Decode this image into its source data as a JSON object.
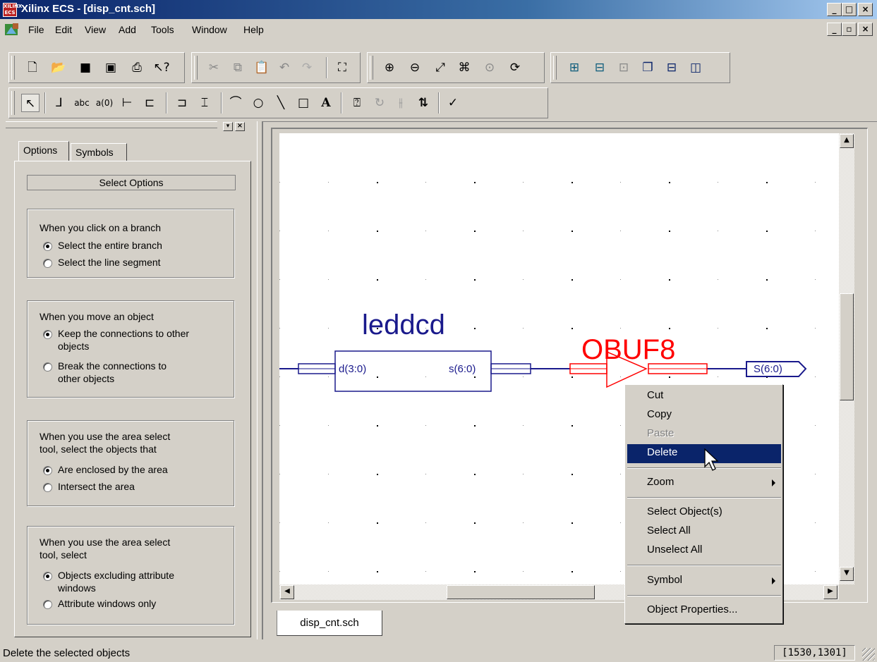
{
  "window": {
    "title": "Xilinx ECS - [disp_cnt.sch]",
    "app_icon_text": "ECS"
  },
  "menubar": {
    "items": [
      "File",
      "Edit",
      "View",
      "Add",
      "Tools",
      "Window",
      "Help"
    ]
  },
  "toolbar_main": {
    "icons": [
      "new-icon",
      "open-icon",
      "save-icon",
      "save-all-icon",
      "print-icon",
      "context-help-icon",
      "cut-icon",
      "copy-icon",
      "paste-icon",
      "undo-icon",
      "redo-icon",
      "find-icon",
      "zoom-in-icon",
      "zoom-out-icon",
      "zoom-full-icon",
      "zoom-to-box-icon",
      "zoom-selected-icon",
      "refresh-icon",
      "hierarchy-push-icon",
      "hierarchy-pop-icon",
      "symbol-icon",
      "cascade-icon",
      "tile-horizontal-icon",
      "tile-vertical-icon"
    ]
  },
  "toolbar_draw": {
    "icons": [
      "select-icon",
      "add-wire-icon",
      "add-net-name-icon",
      "add-bus-tap-icon",
      "add-io-marker-icon",
      "add-symbol-icon",
      "add-bus-icon",
      "add-instance-icon",
      "add-arc-icon",
      "add-circle-icon",
      "add-line-icon",
      "add-rectangle-icon",
      "add-text-icon",
      "symbol-info-icon",
      "rotate-icon",
      "mirror-icon",
      "swap-icon",
      "check-schematic-icon"
    ]
  },
  "left_panel": {
    "tabs": [
      "Options",
      "Symbols"
    ],
    "header": "Select Options",
    "groups": [
      {
        "prompt": [
          "When you click on a branch"
        ],
        "options": [
          {
            "label": [
              "Select the entire branch"
            ],
            "checked": true
          },
          {
            "label": [
              "Select the line segment"
            ],
            "checked": false
          }
        ]
      },
      {
        "prompt": [
          "When you move an object"
        ],
        "options": [
          {
            "label": [
              "Keep the connections to other",
              "objects"
            ],
            "checked": true
          },
          {
            "label": [
              "Break the connections to",
              "other objects"
            ],
            "checked": false
          }
        ]
      },
      {
        "prompt": [
          "When you use the area select",
          "tool, select the objects that"
        ],
        "options": [
          {
            "label": [
              "Are enclosed by the area"
            ],
            "checked": true
          },
          {
            "label": [
              "Intersect the area"
            ],
            "checked": false
          }
        ]
      },
      {
        "prompt": [
          "When you use the area select",
          "tool, select"
        ],
        "options": [
          {
            "label": [
              "Objects excluding attribute",
              "windows"
            ],
            "checked": true
          },
          {
            "label": [
              "Attribute windows only"
            ],
            "checked": false
          }
        ]
      }
    ]
  },
  "schematic": {
    "symbol1": {
      "name": "leddcd",
      "pin_in": "d(3:0)",
      "pin_out": "s(6:0)",
      "color": "#1a1a8c"
    },
    "symbol2": {
      "name": "OBUF8",
      "color": "#ff0000"
    },
    "io_marker": "S(6:0)",
    "sheet_tab": "disp_cnt.sch"
  },
  "context_menu": {
    "items": [
      {
        "label": "Cut",
        "state": "normal"
      },
      {
        "label": "Copy",
        "state": "normal"
      },
      {
        "label": "Paste",
        "state": "disabled"
      },
      {
        "label": "Delete",
        "state": "selected"
      },
      {
        "label": "Zoom",
        "state": "submenu"
      },
      {
        "label": "Select Object(s)",
        "state": "normal"
      },
      {
        "label": "Select All",
        "state": "normal"
      },
      {
        "label": "Unselect All",
        "state": "normal"
      },
      {
        "label": "Symbol",
        "state": "submenu"
      },
      {
        "label": "Object Properties...",
        "state": "normal"
      }
    ]
  },
  "statusbar": {
    "message": "Delete the selected objects",
    "coordinates": "[1530,1301]"
  }
}
